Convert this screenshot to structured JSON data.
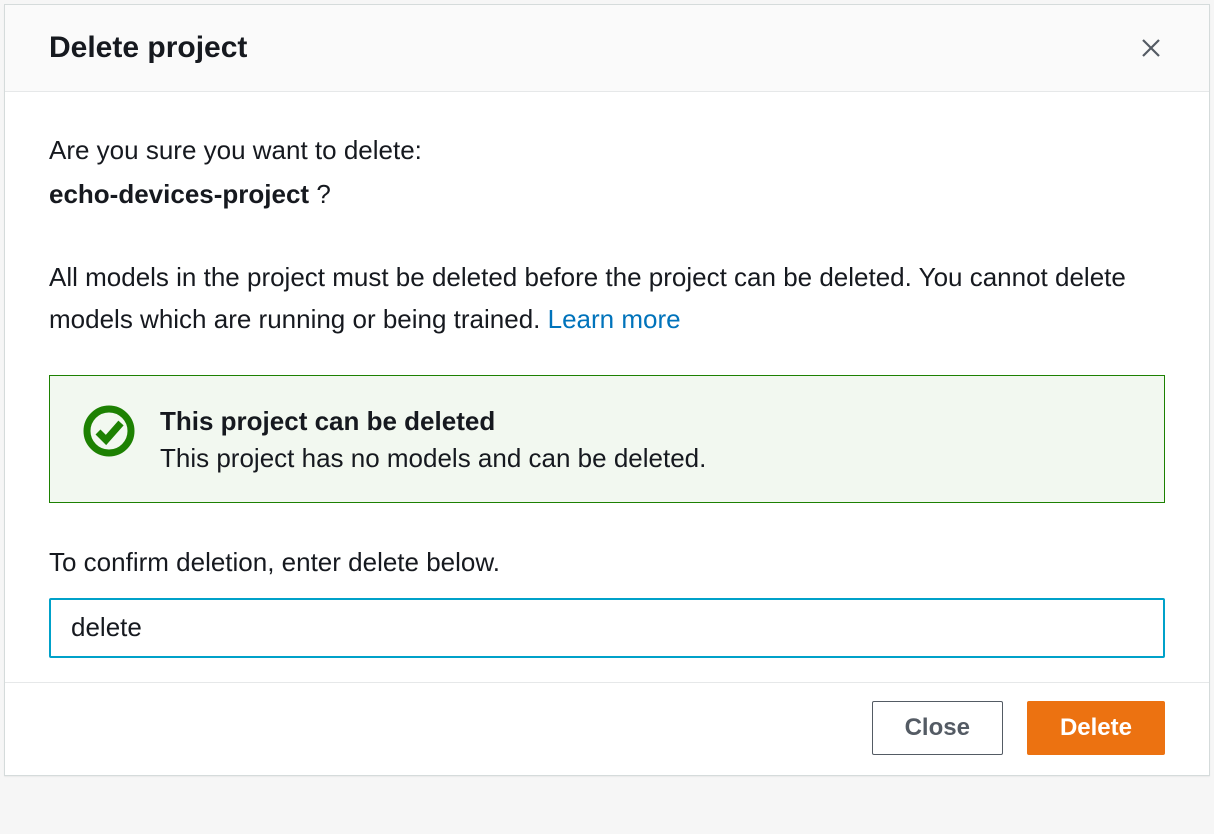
{
  "header": {
    "title": "Delete project"
  },
  "body": {
    "prompt": "Are you sure you want to delete:",
    "project_name": "echo-devices-project",
    "question_mark": " ?",
    "warning_text": "All models in the project must be deleted before the project can be deleted. You cannot delete models which are running or being trained. ",
    "learn_more": "Learn more"
  },
  "alert": {
    "title": "This project can be deleted",
    "description": "This project has no models and can be deleted."
  },
  "confirm": {
    "label": "To confirm deletion, enter delete below.",
    "value": "delete"
  },
  "footer": {
    "close_label": "Close",
    "delete_label": "Delete"
  }
}
